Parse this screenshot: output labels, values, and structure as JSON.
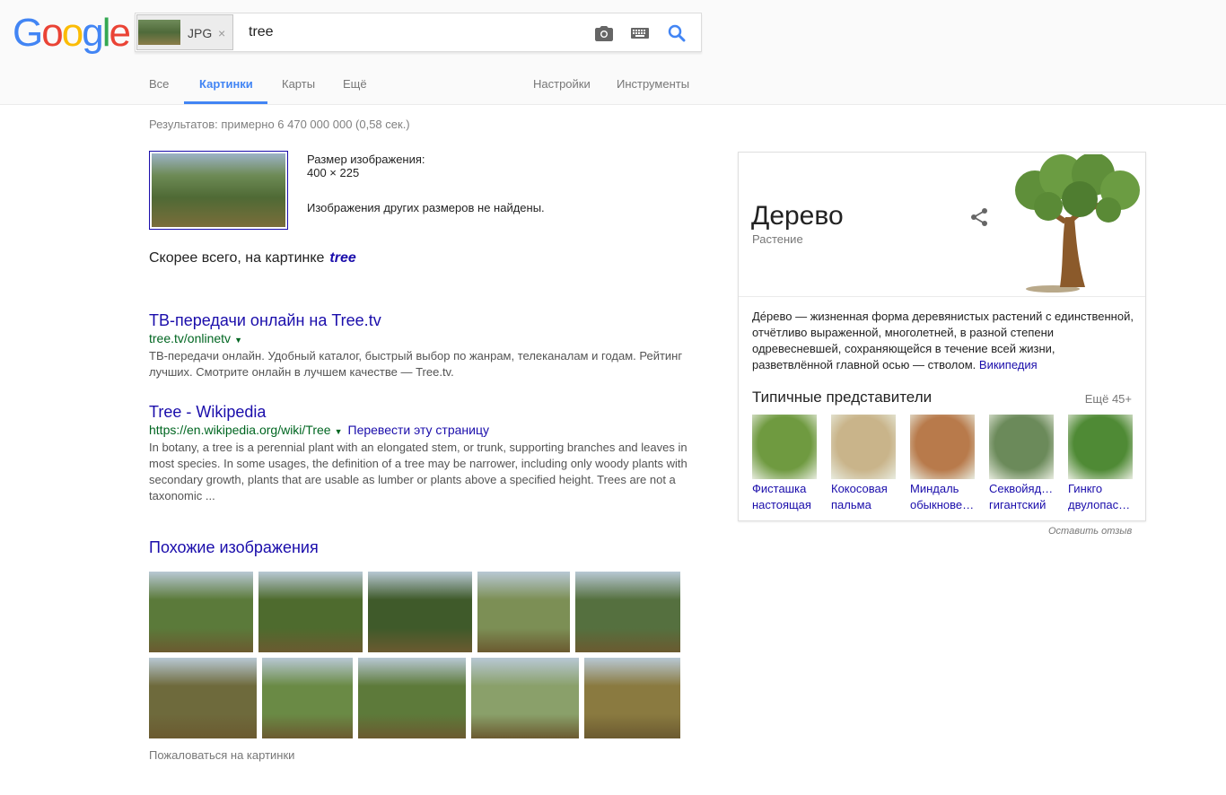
{
  "logo": {
    "letters": [
      "G",
      "o",
      "o",
      "g",
      "l",
      "e"
    ],
    "colors": [
      "#4285f4",
      "#ea4335",
      "#fbbc05",
      "#4285f4",
      "#34a853",
      "#ea4335"
    ]
  },
  "search": {
    "chip_label": "JPG",
    "chip_close": "×",
    "query": "tree"
  },
  "tabs": [
    {
      "label": "Все",
      "active": false
    },
    {
      "label": "Картинки",
      "active": true
    },
    {
      "label": "Карты",
      "active": false
    },
    {
      "label": "Ещё",
      "active": false
    },
    {
      "label": "Настройки",
      "active": false
    },
    {
      "label": "Инструменты",
      "active": false
    }
  ],
  "results_count": "Результатов: примерно 6 470 000 000 (0,58 сек.)",
  "image_info": {
    "size_label": "Размер изображения:",
    "size_value": "400 × 225",
    "no_other_sizes": "Изображения других размеров не найдены."
  },
  "best_guess": {
    "prefix": "Скорее всего, на картинке",
    "term": "tree"
  },
  "results": [
    {
      "title": "ТВ-передачи онлайн на Tree.tv",
      "url": "tree.tv/onlinetv",
      "translate": "",
      "snippet": "ТВ-передачи онлайн. Удобный каталог, быстрый выбор по жанрам, телеканалам и годам. Рейтинг лучших. Смотрите онлайн в лучшем качестве — Tree.tv."
    },
    {
      "title": "Tree - Wikipedia",
      "url": "https://en.wikipedia.org/wiki/Tree",
      "translate": "Перевести эту страницу",
      "snippet": "In botany, a tree is a perennial plant with an elongated stem, or trunk, supporting branches and leaves in most species. In some usages, the definition of a tree may be narrower, including only woody plants with secondary growth, plants that are usable as lumber or plants above a specified height. Trees are not a taxonomic ..."
    }
  ],
  "similar": {
    "title": "Похожие изображения",
    "colors": [
      "#5b7a3a",
      "#4e6b2e",
      "#3f5a2a",
      "#7c8f55",
      "#55703f",
      "#6e6a3c",
      "#6a8a45",
      "#5d7a3a",
      "#8aa06a",
      "#8a7a40"
    ]
  },
  "report_images": "Пожаловаться на картинки",
  "knowledge_panel": {
    "title": "Дерево",
    "subtitle": "Растение",
    "description": "Де́рево — жизненная форма деревянистых растений с единственной, отчётливо выраженной, многолетней, в разной степени одревесневшей, сохраняющейся в течение всей жизни, разветвлённой главной осью — стволом.",
    "source": "Википедия",
    "reps_title": "Типичные представители",
    "reps_more": "Ещё 45+",
    "reps": [
      {
        "line1": "Фисташка",
        "line2": "настоящая",
        "color": "#6f9a40"
      },
      {
        "line1": "Кокосовая",
        "line2": "пальма",
        "color": "#c9b48a"
      },
      {
        "line1": "Миндаль",
        "line2": "обыкнове…",
        "color": "#b87a4b"
      },
      {
        "line1": "Секвойяд…",
        "line2": "гигантский",
        "color": "#6b8a5a"
      },
      {
        "line1": "Гинкго",
        "line2": "двулопас…",
        "color": "#4f8a35"
      }
    ]
  },
  "feedback": "Оставить отзыв"
}
